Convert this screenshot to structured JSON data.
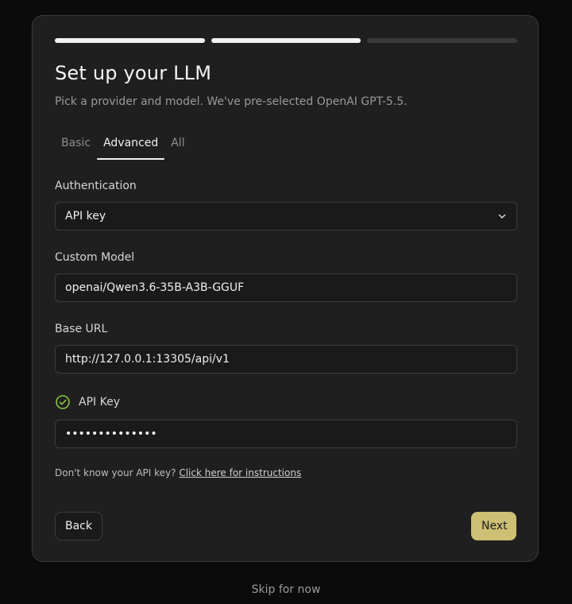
{
  "setup": {
    "progress": {
      "total_steps": 3,
      "completed_steps": 2
    },
    "title": "Set up your LLM",
    "subtitle": "Pick a provider and model. We've pre-selected OpenAI GPT-5.5.",
    "tabs": [
      {
        "label": "Basic",
        "active": false
      },
      {
        "label": "Advanced",
        "active": true
      },
      {
        "label": "All",
        "active": false
      }
    ],
    "authentication": {
      "label": "Authentication",
      "selected": "API key",
      "icon": "chevron-down-icon"
    },
    "custom_model": {
      "label": "Custom Model",
      "value": "openai/Qwen3.6-35B-A3B-GGUF"
    },
    "base_url": {
      "label": "Base URL",
      "value": "http://127.0.0.1:13305/api/v1"
    },
    "api_key": {
      "label": "API Key",
      "value": "••••••••••••••",
      "status_icon": "check-circle-icon",
      "status_color": "#8bc34a"
    },
    "hint": {
      "text": "Don't know your API key?",
      "link": "Click here for instructions"
    },
    "buttons": {
      "back": "Back",
      "next": "Next",
      "next_color": "#cdbf73"
    },
    "skip": "Skip for now"
  }
}
